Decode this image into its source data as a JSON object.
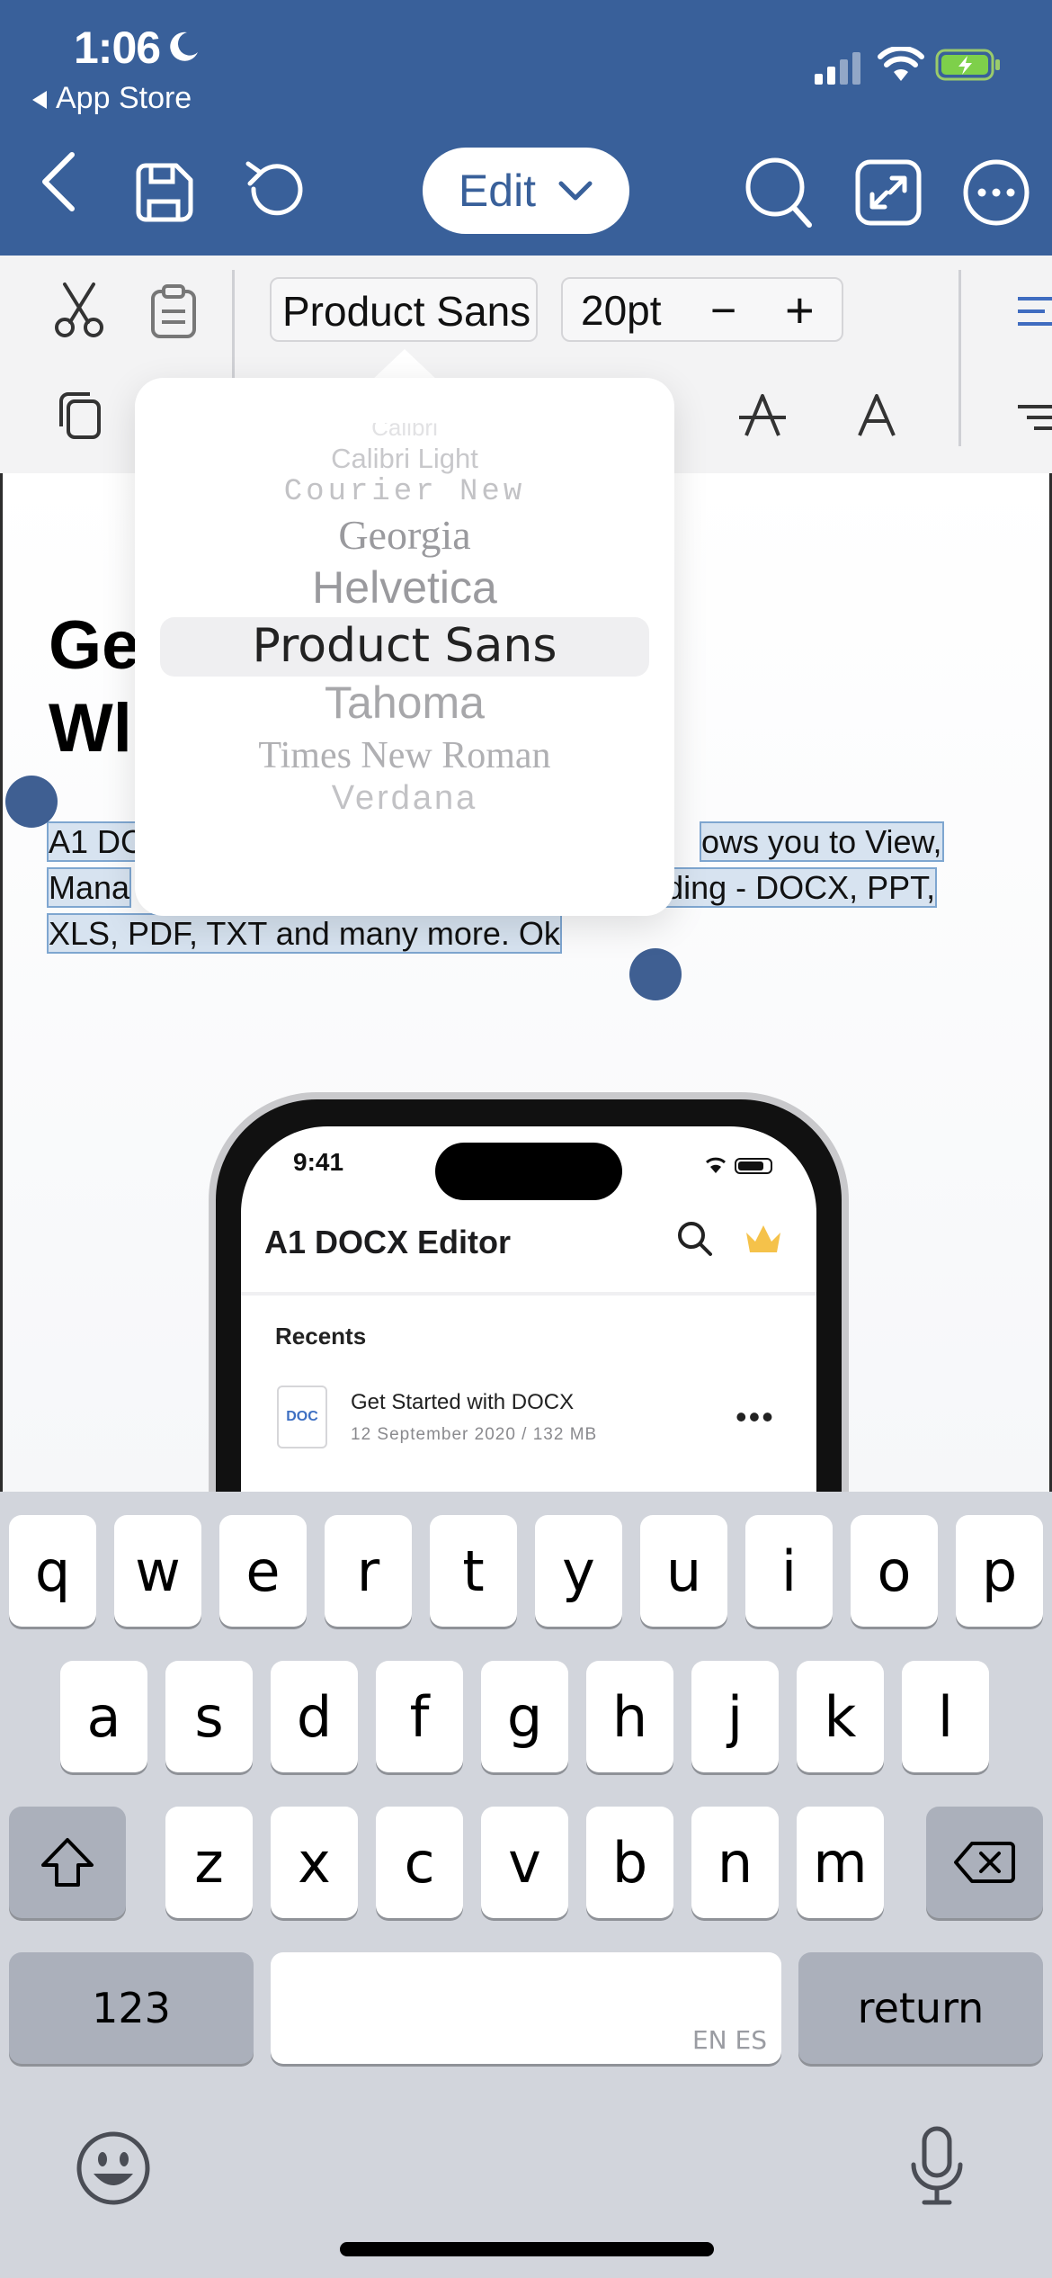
{
  "status_bar": {
    "time": "1:06",
    "back_app": "App Store"
  },
  "header": {
    "edit_label": "Edit"
  },
  "toolbar": {
    "font_name": "Product Sans",
    "font_size": "20pt",
    "minus": "−",
    "plus": "+"
  },
  "font_picker": {
    "options": [
      "Calibri",
      "Calibri Light",
      "Courier New",
      "Georgia",
      "Helvetica",
      "Product Sans",
      "Tahoma",
      "Times New Roman",
      "Verdana"
    ],
    "selected": "Product Sans"
  },
  "document": {
    "heading_line1": "Ge",
    "heading_line2": "Wl",
    "body_line1_a": "A1 DC",
    "body_line1_b": "ows you to View,",
    "body_line2_a": "Mana",
    "body_line2_b": "uding - DOCX, PPT,",
    "body_line3": "XLS, PDF, TXT and many more. Ok"
  },
  "phone_mockup": {
    "time": "9:41",
    "title": "A1 DOCX Editor",
    "recents": "Recents",
    "file_name": "Get Started with DOCX",
    "file_meta": "12 September 2020 / 132 MB",
    "doc_badge": "DOC",
    "more": "•••"
  },
  "keyboard": {
    "row1": [
      "q",
      "w",
      "e",
      "r",
      "t",
      "y",
      "u",
      "i",
      "o",
      "p"
    ],
    "row2": [
      "a",
      "s",
      "d",
      "f",
      "g",
      "h",
      "j",
      "k",
      "l"
    ],
    "row3": [
      "z",
      "x",
      "c",
      "v",
      "b",
      "n",
      "m"
    ],
    "numbers_key": "123",
    "return_key": "return",
    "space_lang": "EN ES"
  },
  "colors": {
    "header_bg": "#39609a",
    "selection": "#d7e3f0",
    "handle": "#3f5f92",
    "keyboard_bg": "#d2d5dc"
  }
}
